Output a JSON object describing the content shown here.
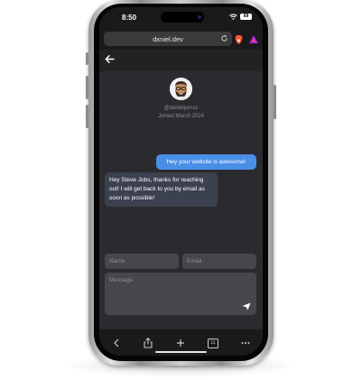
{
  "status": {
    "time": "8:50",
    "battery": "69"
  },
  "browser": {
    "url": "dxniel.dev"
  },
  "profile": {
    "handle": "@danielpxnxz",
    "joined": "Joined March 2024"
  },
  "messages": {
    "outgoing": "Hey your website is awesome!",
    "incoming": "Hey Steve Jobs, thanks for reaching out! I will get back to you by email as soon as possible!"
  },
  "form": {
    "name_placeholder": "Name",
    "email_placeholder": "Email",
    "message_placeholder": "Message"
  },
  "toolbar": {
    "tabs_count": "11"
  },
  "colors": {
    "accent": "#4a8fe7",
    "screen_bg": "#2b2b2f",
    "bubble_in": "#3c4150",
    "field_bg": "#45474c"
  },
  "icons": [
    "wifi-icon",
    "battery-icon",
    "reload-icon",
    "brave-lion-icon",
    "brave-rewards-icon",
    "back-arrow-icon",
    "send-icon",
    "chevron-left-icon",
    "share-icon",
    "plus-icon",
    "tabs-icon",
    "more-icon"
  ]
}
